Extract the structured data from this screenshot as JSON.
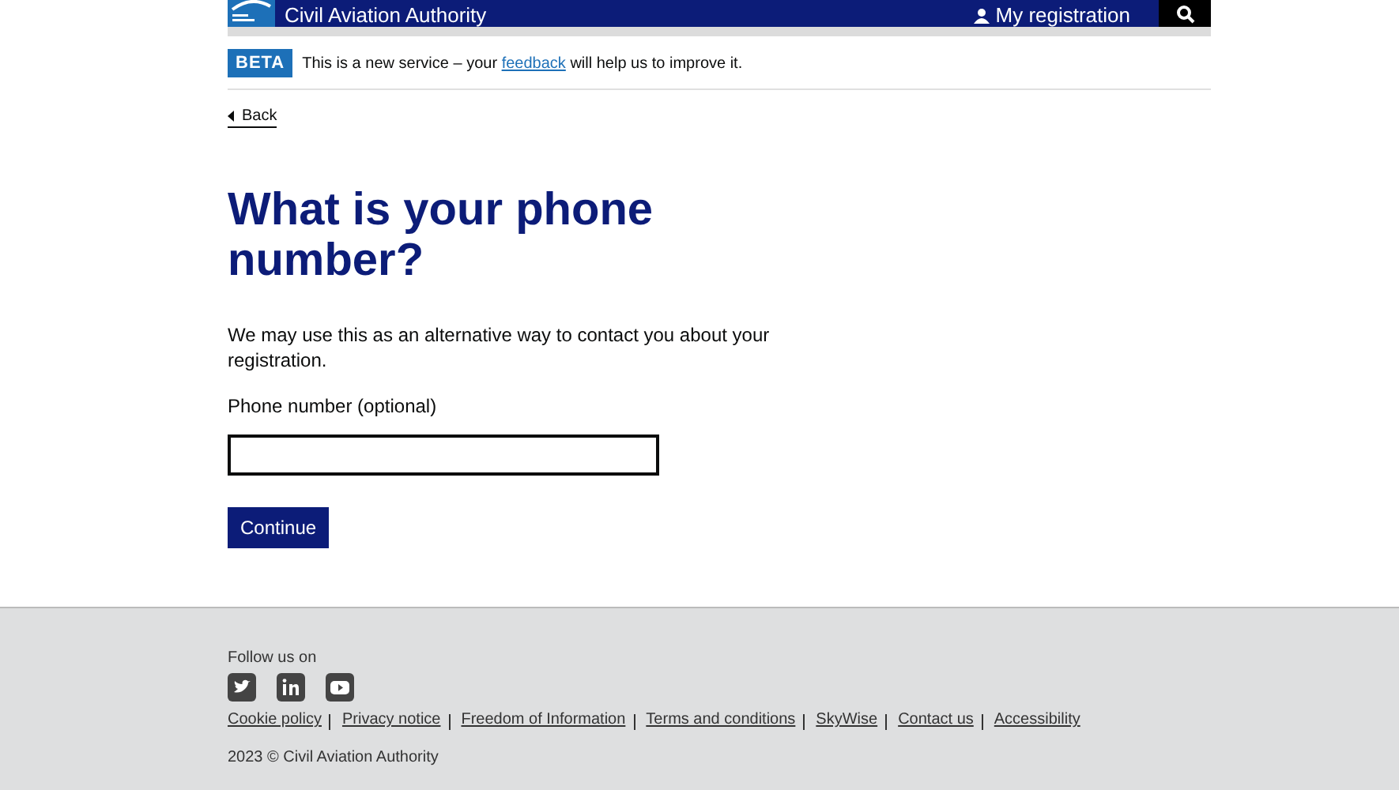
{
  "header": {
    "title": "Civil Aviation Authority",
    "account_link": "My registration"
  },
  "phase_banner": {
    "tag": "BETA",
    "text_before": "This is a new service – your",
    "link": "feedback",
    "text_after": "will help us to improve it."
  },
  "back_link": "Back",
  "heading": "What is your phone number?",
  "hint": "We may use this as an alternative way to contact you about your registration.",
  "field": {
    "label": "Phone number (optional)"
  },
  "button": "Continue",
  "footer": {
    "follow": "Follow us on",
    "links": [
      "Cookie policy",
      "Privacy notice",
      "Freedom of Information",
      "Terms and conditions",
      "SkyWise",
      "Contact us",
      "Accessibility"
    ],
    "copyright": "2023 © Civil Aviation Authority"
  }
}
